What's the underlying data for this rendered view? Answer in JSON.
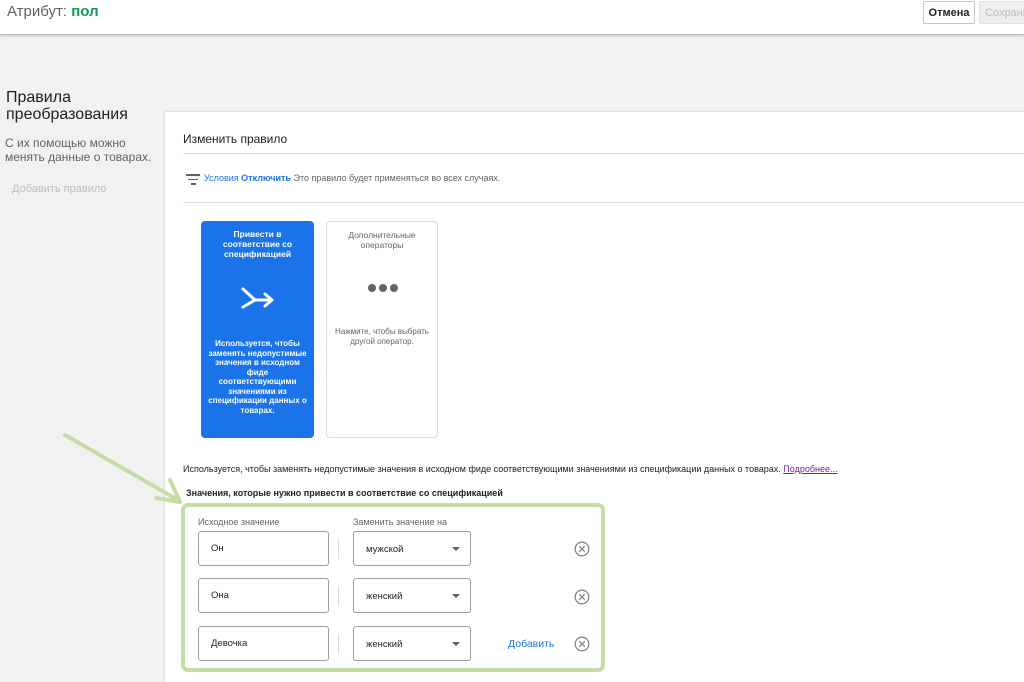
{
  "header": {
    "attribute_label": "Атрибут:",
    "attribute_value": "пол",
    "cancel_label": "Отмена",
    "save_label": "Сохранить"
  },
  "sidebar": {
    "title": "Правила преобразования",
    "description": "С их помощью можно менять данные о товарах.",
    "add_rule_label": "Добавить правило"
  },
  "panel": {
    "title": "Изменить правило",
    "conditions": {
      "label": "Условия",
      "toggle_label": "Отключить",
      "text": "Это правило будет применяться во всех случаях."
    },
    "operators": [
      {
        "title": "Привести в соответствие со спецификацией",
        "description": "Используется, чтобы заменять недопустимые значения в исходном фиде соответствующими значениями из спецификации данных о товарах.",
        "selected": true
      },
      {
        "title": "Дополнительные операторы",
        "description": "Нажмите, чтобы выбрать другой оператор.",
        "selected": false
      }
    ],
    "description": "Используется, чтобы заменять недопустимые значения в исходном фиде соответствующими значениями из спецификации данных о товарах.",
    "more_link": "Подробнее...",
    "section_title": "Значения, которые нужно привести в соответствие со спецификацией",
    "mapping": {
      "source_header": "Исходное значение",
      "target_header": "Заменить значение на",
      "rows": [
        {
          "source": "Он",
          "target": "мужской"
        },
        {
          "source": "Она",
          "target": "женский"
        },
        {
          "source": "Девочка",
          "target": "женский"
        }
      ],
      "add_label": "Добавить"
    }
  },
  "colors": {
    "accent": "#1a73e8",
    "attribute_green": "#0f9d58",
    "highlight_green": "#c5dca5",
    "link_visited": "#7b1fa2"
  },
  "icons": {
    "filter": "filter-lines-icon",
    "merge": "merge-arrow-icon",
    "more": "more-horiz-icon",
    "remove": "remove-circle-icon"
  }
}
